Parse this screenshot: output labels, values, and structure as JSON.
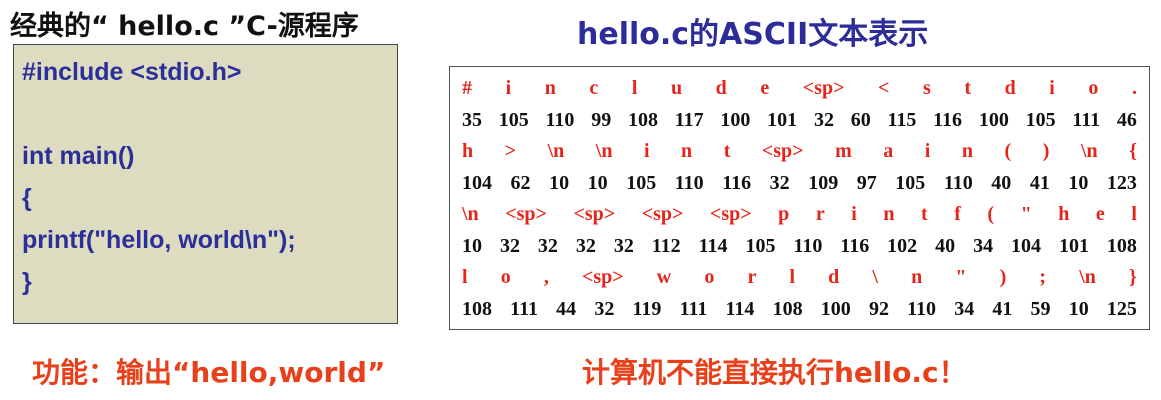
{
  "left_title": "经典的“ hello.c ”C-源程序",
  "right_title": "hello.c的ASCII文本表示",
  "code_lines": [
    "#include <stdio.h>",
    "",
    "int main()",
    "{",
    "printf(\"hello, world\\n\");",
    "}"
  ],
  "ascii_rows": [
    {
      "kind": "chars",
      "tokens": [
        "#",
        "i",
        "n",
        "c",
        "l",
        "u",
        "d",
        "e",
        "<sp>",
        "<",
        "s",
        "t",
        "d",
        "i",
        "o",
        "."
      ]
    },
    {
      "kind": "codes",
      "tokens": [
        "35",
        "105",
        "110",
        "99",
        "108",
        "117",
        "100",
        "101",
        "32",
        "60",
        "115",
        "116",
        "100",
        "105",
        "111",
        "46"
      ]
    },
    {
      "kind": "chars",
      "tokens": [
        "h",
        ">",
        "\\n",
        "\\n",
        "i",
        "n",
        "t",
        "<sp>",
        "m",
        "a",
        "i",
        "n",
        "(",
        ")",
        "\\n",
        "{"
      ]
    },
    {
      "kind": "codes",
      "tokens": [
        "104",
        "62",
        "10",
        "10",
        "105",
        "110",
        "116",
        "32",
        "109",
        "97",
        "105",
        "110",
        "40",
        "41",
        "10",
        "123"
      ]
    },
    {
      "kind": "chars",
      "tokens": [
        "\\n",
        "<sp>",
        "<sp>",
        "<sp>",
        "<sp>",
        "p",
        "r",
        "i",
        "n",
        "t",
        "f",
        "(",
        "\"",
        "h",
        "e",
        "l"
      ]
    },
    {
      "kind": "codes",
      "tokens": [
        "10",
        "32",
        "32",
        "32",
        "32",
        "112",
        "114",
        "105",
        "110",
        "116",
        "102",
        "40",
        "34",
        "104",
        "101",
        "108"
      ]
    },
    {
      "kind": "chars",
      "tokens": [
        "l",
        "o",
        ",",
        "<sp>",
        "w",
        "o",
        "r",
        "l",
        "d",
        "\\",
        "n",
        "\"",
        ")",
        ";",
        "\\n",
        "}"
      ]
    },
    {
      "kind": "codes",
      "tokens": [
        "108",
        "111",
        "44",
        "32",
        "119",
        "111",
        "114",
        "108",
        "100",
        "92",
        "110",
        "34",
        "41",
        "59",
        "10",
        "125"
      ]
    }
  ],
  "bottom_left": "功能：输出“hello,world”",
  "bottom_right": "计算机不能直接执行hello.c！",
  "colors": {
    "code_bg": "#dedcc0",
    "code_text": "#2b2f9a",
    "title_blue": "#2d2d9a",
    "ascii_char_red": "#e5241a",
    "ascii_code_black": "#111111",
    "bottom_red": "#e8401a"
  }
}
